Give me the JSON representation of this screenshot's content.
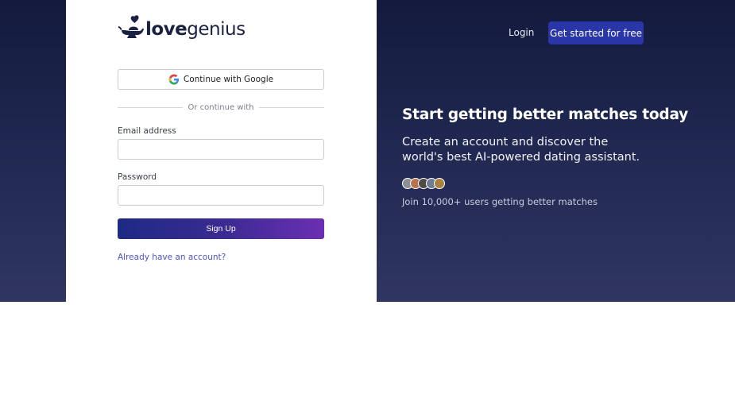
{
  "brand": {
    "logo_bold": "love",
    "logo_light": "genius"
  },
  "form": {
    "google_label": "Continue with Google",
    "divider_text": "Or continue with",
    "email_label": "Email address",
    "email_value": "",
    "password_label": "Password",
    "password_value": "",
    "submit_label": "Sign Up",
    "account_link": "Already have an account?"
  },
  "nav": {
    "login_label": "Login",
    "cta_label": "Get started for free"
  },
  "hero": {
    "title": "Start getting better matches today",
    "subtitle": "Create an account and discover the world's best AI-powered dating assistant.",
    "avatar_count": 5,
    "join_text": "Join 10,000+ users getting better matches"
  },
  "colors": {
    "background_top": "#131a3e",
    "background_bottom": "#2f3660",
    "cta": "#2a35a8",
    "signup_gradient_start": "#1e2a84",
    "signup_gradient_end": "#6b2fb3",
    "link": "#4b50c8"
  },
  "icons": {
    "google": "google-g-icon",
    "logo": "genie-lamp-heart-icon"
  }
}
